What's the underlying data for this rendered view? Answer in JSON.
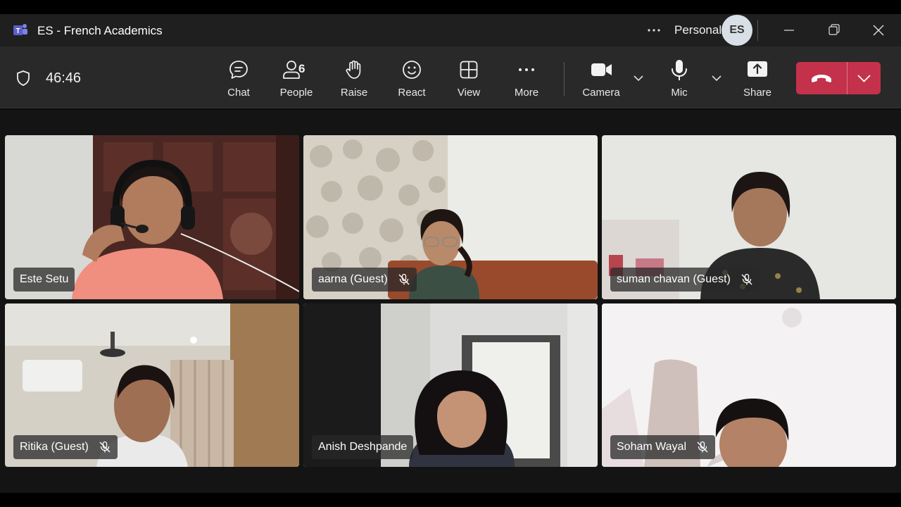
{
  "window": {
    "title": "ES - French Academics",
    "account_label": "Personal",
    "avatar_initials": "ES"
  },
  "toolbar": {
    "timer": "46:46",
    "buttons": {
      "chat": "Chat",
      "people": "People",
      "people_count": "6",
      "raise": "Raise",
      "react": "React",
      "view": "View",
      "more": "More",
      "camera": "Camera",
      "mic": "Mic",
      "share": "Share"
    },
    "colors": {
      "leave": "#c4314b",
      "background": "#292929"
    }
  },
  "participants": [
    {
      "name": "Este Setu",
      "muted": false
    },
    {
      "name": "aarna (Guest)",
      "muted": true
    },
    {
      "name": "suman chavan (Guest)",
      "muted": true
    },
    {
      "name": "Ritika (Guest)",
      "muted": true
    },
    {
      "name": "Anish Deshpande",
      "muted": false,
      "active_speaker": true
    },
    {
      "name": "Soham Wayal",
      "muted": true
    }
  ],
  "accent_color": "#8b8cf0"
}
